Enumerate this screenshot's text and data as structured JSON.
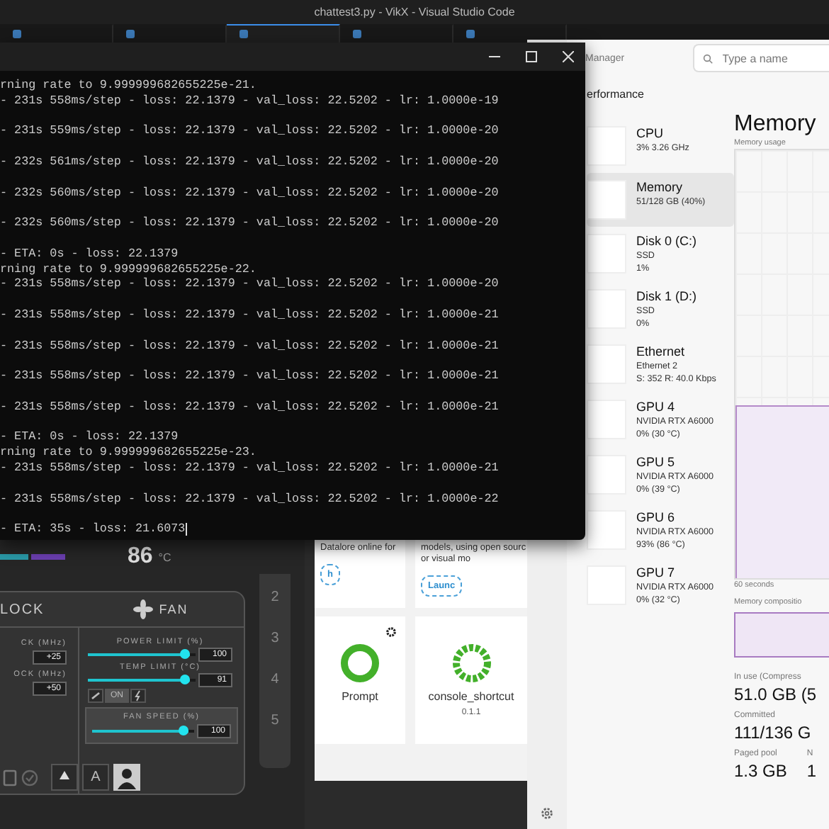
{
  "vscode": {
    "title": "chattest3.py - VikX - Visual Studio Code",
    "tabs": [
      {
        "selected": false
      },
      {
        "selected": false
      },
      {
        "selected": true
      },
      {
        "selected": false
      },
      {
        "selected": false
      }
    ]
  },
  "terminal": {
    "lines": [
      {
        "kind": "info",
        "text": "rning rate to 9.999999682655225e-21."
      },
      {
        "kind": "step",
        "text": "- 231s 558ms/step - loss: 22.1379 - val_loss: 22.5202 - lr: 1.0000e-19"
      },
      {
        "kind": "step",
        "text": "- 231s 559ms/step - loss: 22.1379 - val_loss: 22.5202 - lr: 1.0000e-20"
      },
      {
        "kind": "step",
        "text": "- 232s 561ms/step - loss: 22.1379 - val_loss: 22.5202 - lr: 1.0000e-20"
      },
      {
        "kind": "step",
        "text": "- 232s 560ms/step - loss: 22.1379 - val_loss: 22.5202 - lr: 1.0000e-20"
      },
      {
        "kind": "step",
        "text": "- 232s 560ms/step - loss: 22.1379 - val_loss: 22.5202 - lr: 1.0000e-20"
      },
      {
        "kind": "info",
        "text": "- ETA: 0s - loss: 22.1379"
      },
      {
        "kind": "info",
        "text": "rning rate to 9.999999682655225e-22."
      },
      {
        "kind": "step",
        "text": "- 231s 558ms/step - loss: 22.1379 - val_loss: 22.5202 - lr: 1.0000e-20"
      },
      {
        "kind": "step",
        "text": "- 231s 558ms/step - loss: 22.1379 - val_loss: 22.5202 - lr: 1.0000e-21"
      },
      {
        "kind": "step",
        "text": "- 231s 558ms/step - loss: 22.1379 - val_loss: 22.5202 - lr: 1.0000e-21"
      },
      {
        "kind": "step",
        "text": "- 231s 558ms/step - loss: 22.1379 - val_loss: 22.5202 - lr: 1.0000e-21"
      },
      {
        "kind": "step",
        "text": "- 231s 558ms/step - loss: 22.1379 - val_loss: 22.5202 - lr: 1.0000e-21"
      },
      {
        "kind": "info",
        "text": "- ETA: 0s - loss: 22.1379"
      },
      {
        "kind": "info",
        "text": "rning rate to 9.999999682655225e-23."
      },
      {
        "kind": "step",
        "text": "- 231s 558ms/step - loss: 22.1379 - val_loss: 22.5202 - lr: 1.0000e-21"
      },
      {
        "kind": "step",
        "text": "- 231s 558ms/step - loss: 22.1379 - val_loss: 22.5202 - lr: 1.0000e-22"
      },
      {
        "kind": "prompt",
        "text": "- ETA: 35s - loss: 21.6073"
      }
    ]
  },
  "task_manager": {
    "title": "Manager",
    "search": {
      "placeholder": "Type a name"
    },
    "section": "erformance",
    "items": [
      {
        "name": "CPU",
        "details": [
          "3% 3.26 GHz"
        ],
        "selected": false
      },
      {
        "name": "Memory",
        "details": [
          "51/128 GB (40%)"
        ],
        "selected": true
      },
      {
        "name": "Disk 0 (C:)",
        "details": [
          "SSD",
          "1%"
        ],
        "selected": false
      },
      {
        "name": "Disk 1 (D:)",
        "details": [
          "SSD",
          "0%"
        ],
        "selected": false
      },
      {
        "name": "Ethernet",
        "details": [
          "Ethernet 2",
          "S: 352 R: 40.0 Kbps"
        ],
        "selected": false
      },
      {
        "name": "GPU 4",
        "details": [
          "NVIDIA RTX A6000",
          "0% (30 °C)"
        ],
        "selected": false
      },
      {
        "name": "GPU 5",
        "details": [
          "NVIDIA RTX A6000",
          "0% (39 °C)"
        ],
        "selected": false
      },
      {
        "name": "GPU 6",
        "details": [
          "NVIDIA RTX A6000",
          "93% (86 °C)"
        ],
        "selected": false
      },
      {
        "name": "GPU 7",
        "details": [
          "NVIDIA RTX A6000",
          "0% (32 °C)"
        ],
        "selected": false
      }
    ],
    "detail": {
      "title": "Memory",
      "usage_label": "Memory usage",
      "level": 0.4,
      "time_label": "60 seconds",
      "composition_label": "Memory compositio",
      "stat_rows": [
        [
          {
            "label": "In use (Compress",
            "value": "51.0 GB (5"
          }
        ],
        [
          {
            "label": "Committed",
            "value": "111/136 G"
          }
        ],
        [
          {
            "label": "Paged pool",
            "value": "1.3 GB"
          },
          {
            "label": "N",
            "value": "1"
          }
        ]
      ]
    }
  },
  "web_page": {
    "top_cards": [
      {
        "lines": [
          "Datalore online for"
        ],
        "button": "h"
      },
      {
        "lines": [
          "models, using open sourc",
          "or visual mo"
        ],
        "button": "Launc"
      }
    ],
    "apps": [
      {
        "name": "Prompt",
        "settings": true
      },
      {
        "name": "console_shortcut",
        "version": "0.1.1",
        "settings": false
      }
    ]
  },
  "afterburner": {
    "temperature": "86",
    "temp_unit": "°C",
    "clock_header": "LOCK",
    "fan_header": "FAN",
    "clock_rows": [
      {
        "label": "CK (MHz)",
        "value": "+25"
      },
      {
        "label": "OCK (MHz)",
        "value": "+50"
      }
    ],
    "sliders": [
      {
        "label": "POWER LIMIT (%)",
        "value": "100",
        "level": 0.95
      },
      {
        "label": "TEMP LIMIT (°C)",
        "value": "91",
        "level": 0.95
      }
    ],
    "link_toggle": "ON",
    "fan_speed": {
      "label": "FAN SPEED (%)",
      "value": "100",
      "level": 0.95
    },
    "auto_button": "A",
    "profiles": [
      "2",
      "3",
      "4",
      "5"
    ]
  }
}
